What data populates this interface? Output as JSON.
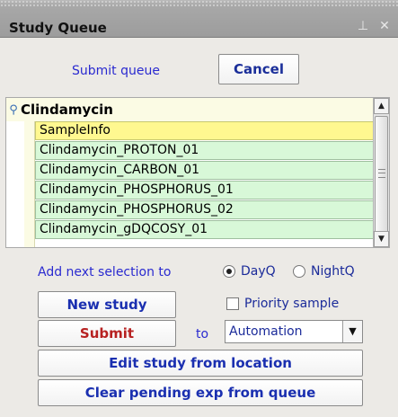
{
  "window": {
    "title": "Study Queue",
    "icons": [
      {
        "name": "pin-icon",
        "glyph": "⊥"
      },
      {
        "name": "close-icon",
        "glyph": "✕"
      }
    ]
  },
  "queue": {
    "submit_label": "Submit queue",
    "cancel_label": "Cancel"
  },
  "tree": {
    "root_label": "Clindamycin",
    "items": [
      "SampleInfo",
      "Clindamycin_PROTON_01",
      "Clindamycin_CARBON_01",
      "Clindamycin_PHOSPHORUS_01",
      "Clindamycin_PHOSPHORUS_02",
      "Clindamycin_gDQCOSY_01"
    ]
  },
  "options": {
    "add_next_label": "Add next selection to",
    "dayq_label": "DayQ",
    "nightq_label": "NightQ",
    "dayq_selected": true,
    "priority_label": "Priority sample",
    "priority_checked": false,
    "to_label": "to",
    "location_value": "Automation"
  },
  "actions": {
    "new_study_label": "New study",
    "submit_label": "Submit",
    "edit_study_label": "Edit study from location",
    "clear_pending_label": "Clear pending exp from queue"
  },
  "colors": {
    "accent_text": "#2a2ad0",
    "submit_text": "#b72121",
    "item_bg": "#d8f8d8",
    "sample_bg": "#fff890"
  }
}
